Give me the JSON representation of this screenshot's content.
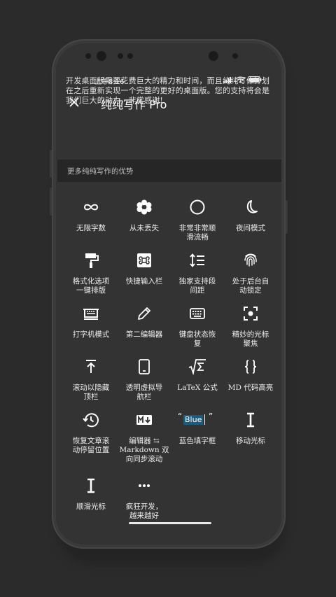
{
  "status": {
    "time": "上午8:16"
  },
  "header": {
    "title": "纯纯写作 Pro",
    "close_icon": "close-icon"
  },
  "description": "开发桌面版需要花费巨大的精力和时间，而且纯纯写作计划在之后重新实现一个完整的更好的桌面版。您的支持将会是我们巨大的动力，非常感谢!",
  "section": {
    "label": "更多纯纯写作的优势"
  },
  "features": [
    {
      "icon": "infinity-icon",
      "label": "无限字数"
    },
    {
      "icon": "flower-icon",
      "label": "从未丢失"
    },
    {
      "icon": "circle-icon",
      "label": "非常非常顺\n滑流畅"
    },
    {
      "icon": "moon-icon",
      "label": "夜间模式"
    },
    {
      "icon": "paint-roller-icon",
      "label": "格式化选项\n一键排版"
    },
    {
      "icon": "command-key-icon",
      "label": "快捷输入栏"
    },
    {
      "icon": "line-spacing-icon",
      "label": "独家支持段\n间距"
    },
    {
      "icon": "fingerprint-icon",
      "label": "处于后台自\n动锁定"
    },
    {
      "icon": "typewriter-icon",
      "label": "打字机模式"
    },
    {
      "icon": "pencil-icon",
      "label": "第二编辑器"
    },
    {
      "icon": "keyboard-icon",
      "label": "键盘状态恢\n复"
    },
    {
      "icon": "focus-cursor-icon",
      "label": "精妙的光标\n聚焦"
    },
    {
      "icon": "scroll-top-icon",
      "label": "滚动以隐藏\n顶栏"
    },
    {
      "icon": "tablet-icon",
      "label": "透明虚拟导\n航栏"
    },
    {
      "icon": "sqrt-sigma-icon",
      "label": "LaTeX 公式"
    },
    {
      "icon": "braces-icon",
      "label": "MD 代码高亮"
    },
    {
      "icon": "history-icon",
      "label": "恢复文章滚\n动停留位置"
    },
    {
      "icon": "markdown-icon",
      "label": "编辑器 ⇆\nMarkdown 双\n向同步滚动"
    },
    {
      "icon": "blue-highlight-icon",
      "label": "蓝色填字框",
      "sample_text": "Blue"
    },
    {
      "icon": "text-cursor-icon",
      "label": "移动光标"
    },
    {
      "icon": "text-cursor-icon",
      "label": "顺滑光标"
    },
    {
      "icon": "more-dots-icon",
      "label": "疯狂开发，\n越来越好"
    }
  ]
}
